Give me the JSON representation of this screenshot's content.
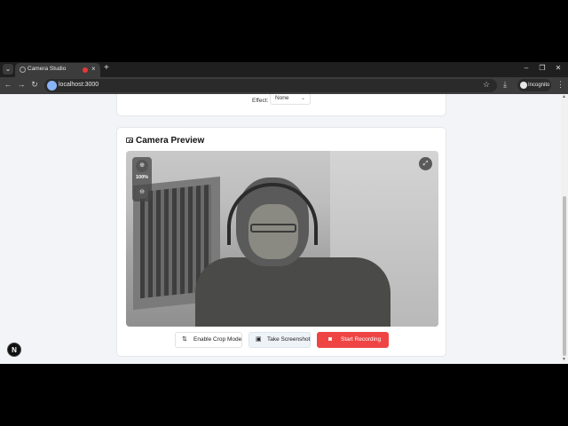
{
  "browser": {
    "tab_title": "Camera Studio",
    "url": "localhost:3000",
    "incognito_label": "Incognito",
    "icons": [
      "tab-menu-icon",
      "close-icon",
      "plus-icon",
      "minimize-icon",
      "restore-icon",
      "back-icon",
      "forward-icon",
      "reload-icon",
      "star-icon",
      "download-icon",
      "incognito-icon",
      "kebab-icon"
    ]
  },
  "controls": {
    "effect_label": "Effect:",
    "effect_value": "None"
  },
  "preview": {
    "title": "Camera Preview",
    "zoom_level": "100%"
  },
  "actions": {
    "crop_label": "Enable Crop Mode",
    "screenshot_label": "Take Screenshot",
    "record_label": "Start Recording"
  },
  "badge": {
    "label": "N"
  },
  "colors": {
    "record": "#ef4444",
    "page_bg": "#f2f4f7"
  }
}
